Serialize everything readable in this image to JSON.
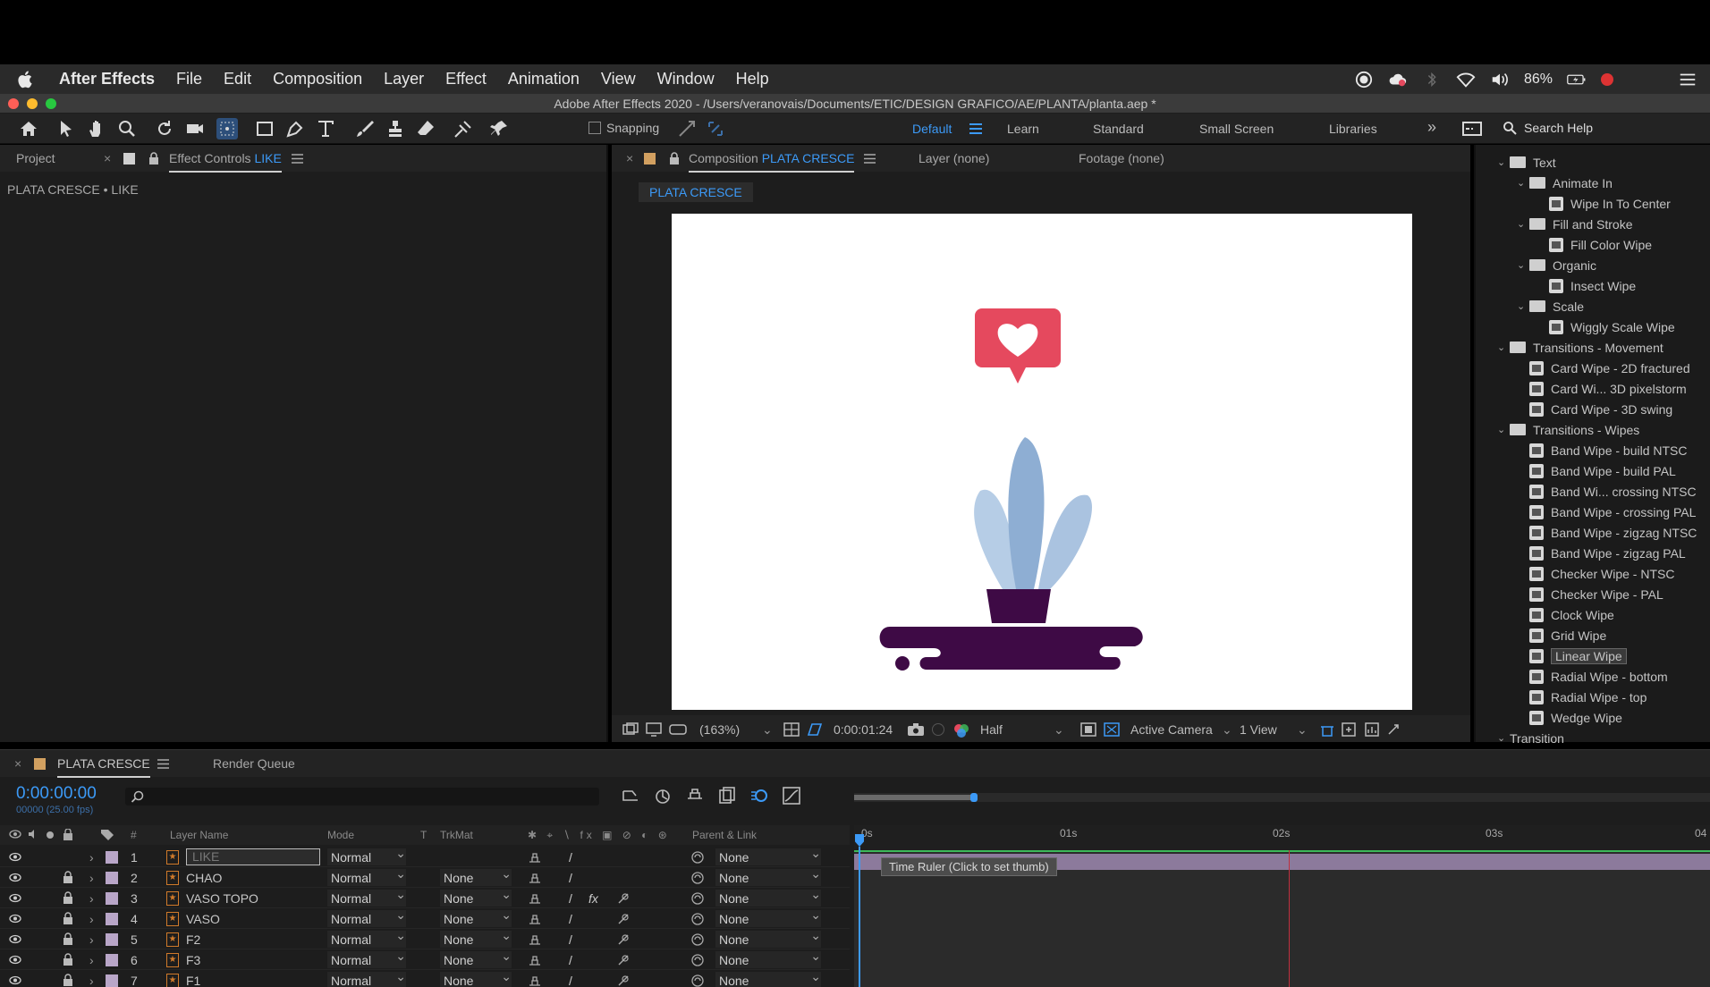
{
  "menubar": {
    "app_name": "After Effects",
    "items": [
      "File",
      "Edit",
      "Composition",
      "Layer",
      "Effect",
      "Animation",
      "View",
      "Window",
      "Help"
    ],
    "battery": "86%"
  },
  "window": {
    "title": "Adobe After Effects 2020 - /Users/veranovais/Documents/ETIC/DESIGN GRAFICO/AE/PLANTA/planta.aep *"
  },
  "toolbar": {
    "snapping_label": "Snapping",
    "workspaces": [
      "Default",
      "Learn",
      "Standard",
      "Small Screen",
      "Libraries"
    ],
    "active_workspace": "Default",
    "overflow": "»",
    "search_help": "Search Help"
  },
  "left_panel": {
    "tab_project": "Project",
    "tab_effect_controls": "Effect Controls",
    "tab_effect_controls_layer": "LIKE",
    "subtitle": "PLATA CRESCE • LIKE"
  },
  "comp_panel": {
    "tab_composition": "Composition",
    "comp_name": "PLATA CRESCE",
    "tab_layer": "Layer (none)",
    "tab_footage": "Footage (none)",
    "comp_tab_label": "PLATA CRESCE",
    "zoom": "(163%)",
    "current_time": "0:00:01:24",
    "resolution": "Half",
    "camera": "Active Camera",
    "views": "1 View"
  },
  "effects_tree": [
    {
      "label": "Text",
      "kind": "folder",
      "depth": 0
    },
    {
      "label": "Animate In",
      "kind": "folder",
      "depth": 1
    },
    {
      "label": "Wipe In To Center",
      "kind": "preset",
      "depth": 2
    },
    {
      "label": "Fill and Stroke",
      "kind": "folder",
      "depth": 1
    },
    {
      "label": "Fill Color Wipe",
      "kind": "preset",
      "depth": 2
    },
    {
      "label": "Organic",
      "kind": "folder",
      "depth": 1
    },
    {
      "label": "Insect Wipe",
      "kind": "preset",
      "depth": 2
    },
    {
      "label": "Scale",
      "kind": "folder",
      "depth": 1
    },
    {
      "label": "Wiggly Scale Wipe",
      "kind": "preset",
      "depth": 2
    },
    {
      "label": "Transitions - Movement",
      "kind": "folder",
      "depth": 0
    },
    {
      "label": "Card Wipe - 2D fractured",
      "kind": "preset",
      "depth": 1
    },
    {
      "label": "Card Wi... 3D pixelstorm",
      "kind": "preset",
      "depth": 1
    },
    {
      "label": "Card Wipe - 3D swing",
      "kind": "preset",
      "depth": 1
    },
    {
      "label": "Transitions - Wipes",
      "kind": "folder",
      "depth": 0
    },
    {
      "label": "Band Wipe - build NTSC",
      "kind": "preset",
      "depth": 1
    },
    {
      "label": "Band Wipe - build PAL",
      "kind": "preset",
      "depth": 1
    },
    {
      "label": "Band Wi... crossing NTSC",
      "kind": "preset",
      "depth": 1
    },
    {
      "label": "Band Wipe - crossing PAL",
      "kind": "preset",
      "depth": 1
    },
    {
      "label": "Band Wipe - zigzag NTSC",
      "kind": "preset",
      "depth": 1
    },
    {
      "label": "Band Wipe - zigzag PAL",
      "kind": "preset",
      "depth": 1
    },
    {
      "label": "Checker Wipe - NTSC",
      "kind": "preset",
      "depth": 1
    },
    {
      "label": "Checker Wipe - PAL",
      "kind": "preset",
      "depth": 1
    },
    {
      "label": "Clock Wipe",
      "kind": "preset",
      "depth": 1
    },
    {
      "label": "Grid Wipe",
      "kind": "preset",
      "depth": 1
    },
    {
      "label": "Linear Wipe",
      "kind": "preset",
      "depth": 1,
      "selected": true
    },
    {
      "label": "Radial Wipe - bottom",
      "kind": "preset",
      "depth": 1
    },
    {
      "label": "Radial Wipe - top",
      "kind": "preset",
      "depth": 1
    },
    {
      "label": "Wedge Wipe",
      "kind": "preset",
      "depth": 1
    },
    {
      "label": "Transition",
      "kind": "category",
      "depth": 0
    }
  ],
  "timeline": {
    "tab_comp": "PLATA CRESCE",
    "tab_render_queue": "Render Queue",
    "timecode": "0:00:00:00",
    "framecode": "00000 (25.00 fps)",
    "columns": {
      "hash": "#",
      "layer_name": "Layer Name",
      "mode": "Mode",
      "t": "T",
      "trkmat": "TrkMat",
      "parent": "Parent & Link"
    },
    "ruler_ticks": [
      "0s",
      "01s",
      "02s",
      "03s",
      "04"
    ],
    "tooltip": "Time Ruler (Click to set thumb)",
    "layers": [
      {
        "num": "1",
        "name": "LIKE",
        "mode": "Normal",
        "trkmat": "",
        "parent": "None",
        "locked": false,
        "selected": true
      },
      {
        "num": "2",
        "name": "CHAO",
        "mode": "Normal",
        "trkmat": "None",
        "parent": "None",
        "locked": true
      },
      {
        "num": "3",
        "name": "VASO TOPO",
        "mode": "Normal",
        "trkmat": "None",
        "parent": "None",
        "locked": true
      },
      {
        "num": "4",
        "name": "VASO",
        "mode": "Normal",
        "trkmat": "None",
        "parent": "None",
        "locked": true
      },
      {
        "num": "5",
        "name": "F2",
        "mode": "Normal",
        "trkmat": "None",
        "parent": "None",
        "locked": true
      },
      {
        "num": "6",
        "name": "F3",
        "mode": "Normal",
        "trkmat": "None",
        "parent": "None",
        "locked": true
      },
      {
        "num": "7",
        "name": "F1",
        "mode": "Normal",
        "trkmat": "None",
        "parent": "None",
        "locked": true
      }
    ]
  },
  "colors": {
    "accent_blue": "#3c9af7",
    "heart_bubble": "#e5495e",
    "leaf_blue": "#9cb8d8",
    "pot_purple": "#3e0a45",
    "layer_label": "#b9a6c8"
  }
}
